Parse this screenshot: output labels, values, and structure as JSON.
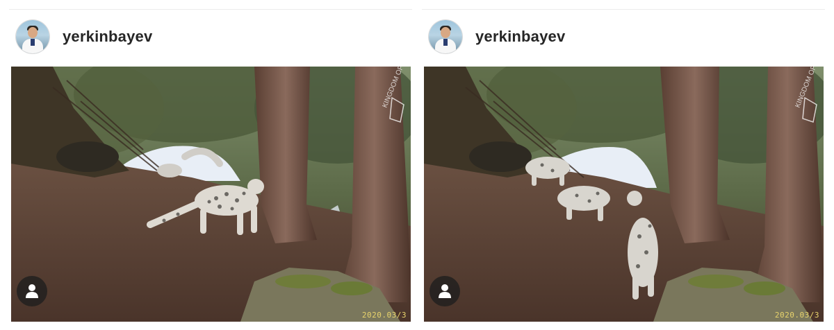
{
  "posts": [
    {
      "username": "yerkinbayev",
      "avatar_icon": "profile-photo",
      "photo_watermark": "KINGDOM OF THE",
      "photo_timestamp": "2020.03/3",
      "tag_icon": "person-icon"
    },
    {
      "username": "yerkinbayev",
      "avatar_icon": "profile-photo",
      "photo_watermark": "KINGDOM OF THE",
      "photo_timestamp": "2020.03/3",
      "tag_icon": "person-icon"
    }
  ],
  "colors": {
    "username_text": "#262626",
    "timestamp_text": "#e9d46c",
    "chip_background": "#1e1e1e"
  }
}
